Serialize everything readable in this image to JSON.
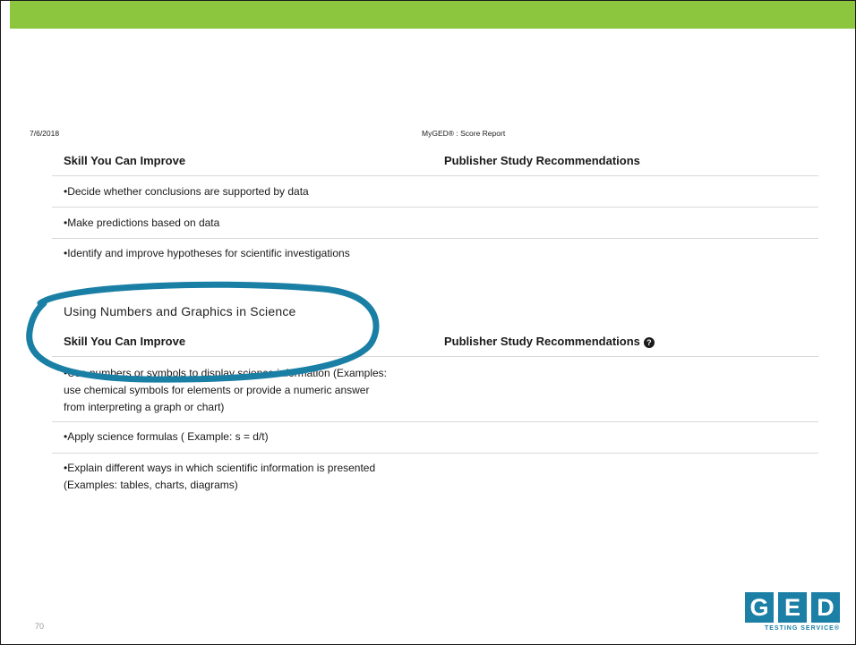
{
  "header": {
    "date": "7/6/2018",
    "title": "MyGED® : Score Report"
  },
  "table1": {
    "col_skill": "Skill You Can Improve",
    "col_publisher": "Publisher Study Recommendations",
    "rows": [
      [
        "•Decide whether conclusions are supported by data"
      ],
      [
        "•Make predictions based on data"
      ],
      [
        "•Identify and improve hypotheses for scientific investigations"
      ]
    ]
  },
  "section2": {
    "title": "Using Numbers and Graphics in Science",
    "col_skill": "Skill You Can Improve",
    "col_publisher": "Publisher Study Recommendations",
    "help_icon": "question-circle-icon",
    "rows": [
      [
        "•Use numbers or symbols to display science information (Examples:",
        "use chemical symbols for elements or provide a numeric answer",
        "from interpreting a graph or chart)"
      ],
      [
        "•Apply science formulas ( Example: s = d/t)"
      ],
      [
        "•Explain different ways in which scientific information is presented",
        "(Examples: tables, charts, diagrams)"
      ]
    ]
  },
  "annotation": {
    "color": "#1a7fa5"
  },
  "footer": {
    "page_number": "70",
    "logo_letters": [
      "G",
      "E",
      "D"
    ],
    "logo_subtitle": "TESTING SERVICE®"
  },
  "colors": {
    "accent_bar": "#8cc63f",
    "logo_blue": "#1b7fa6"
  }
}
